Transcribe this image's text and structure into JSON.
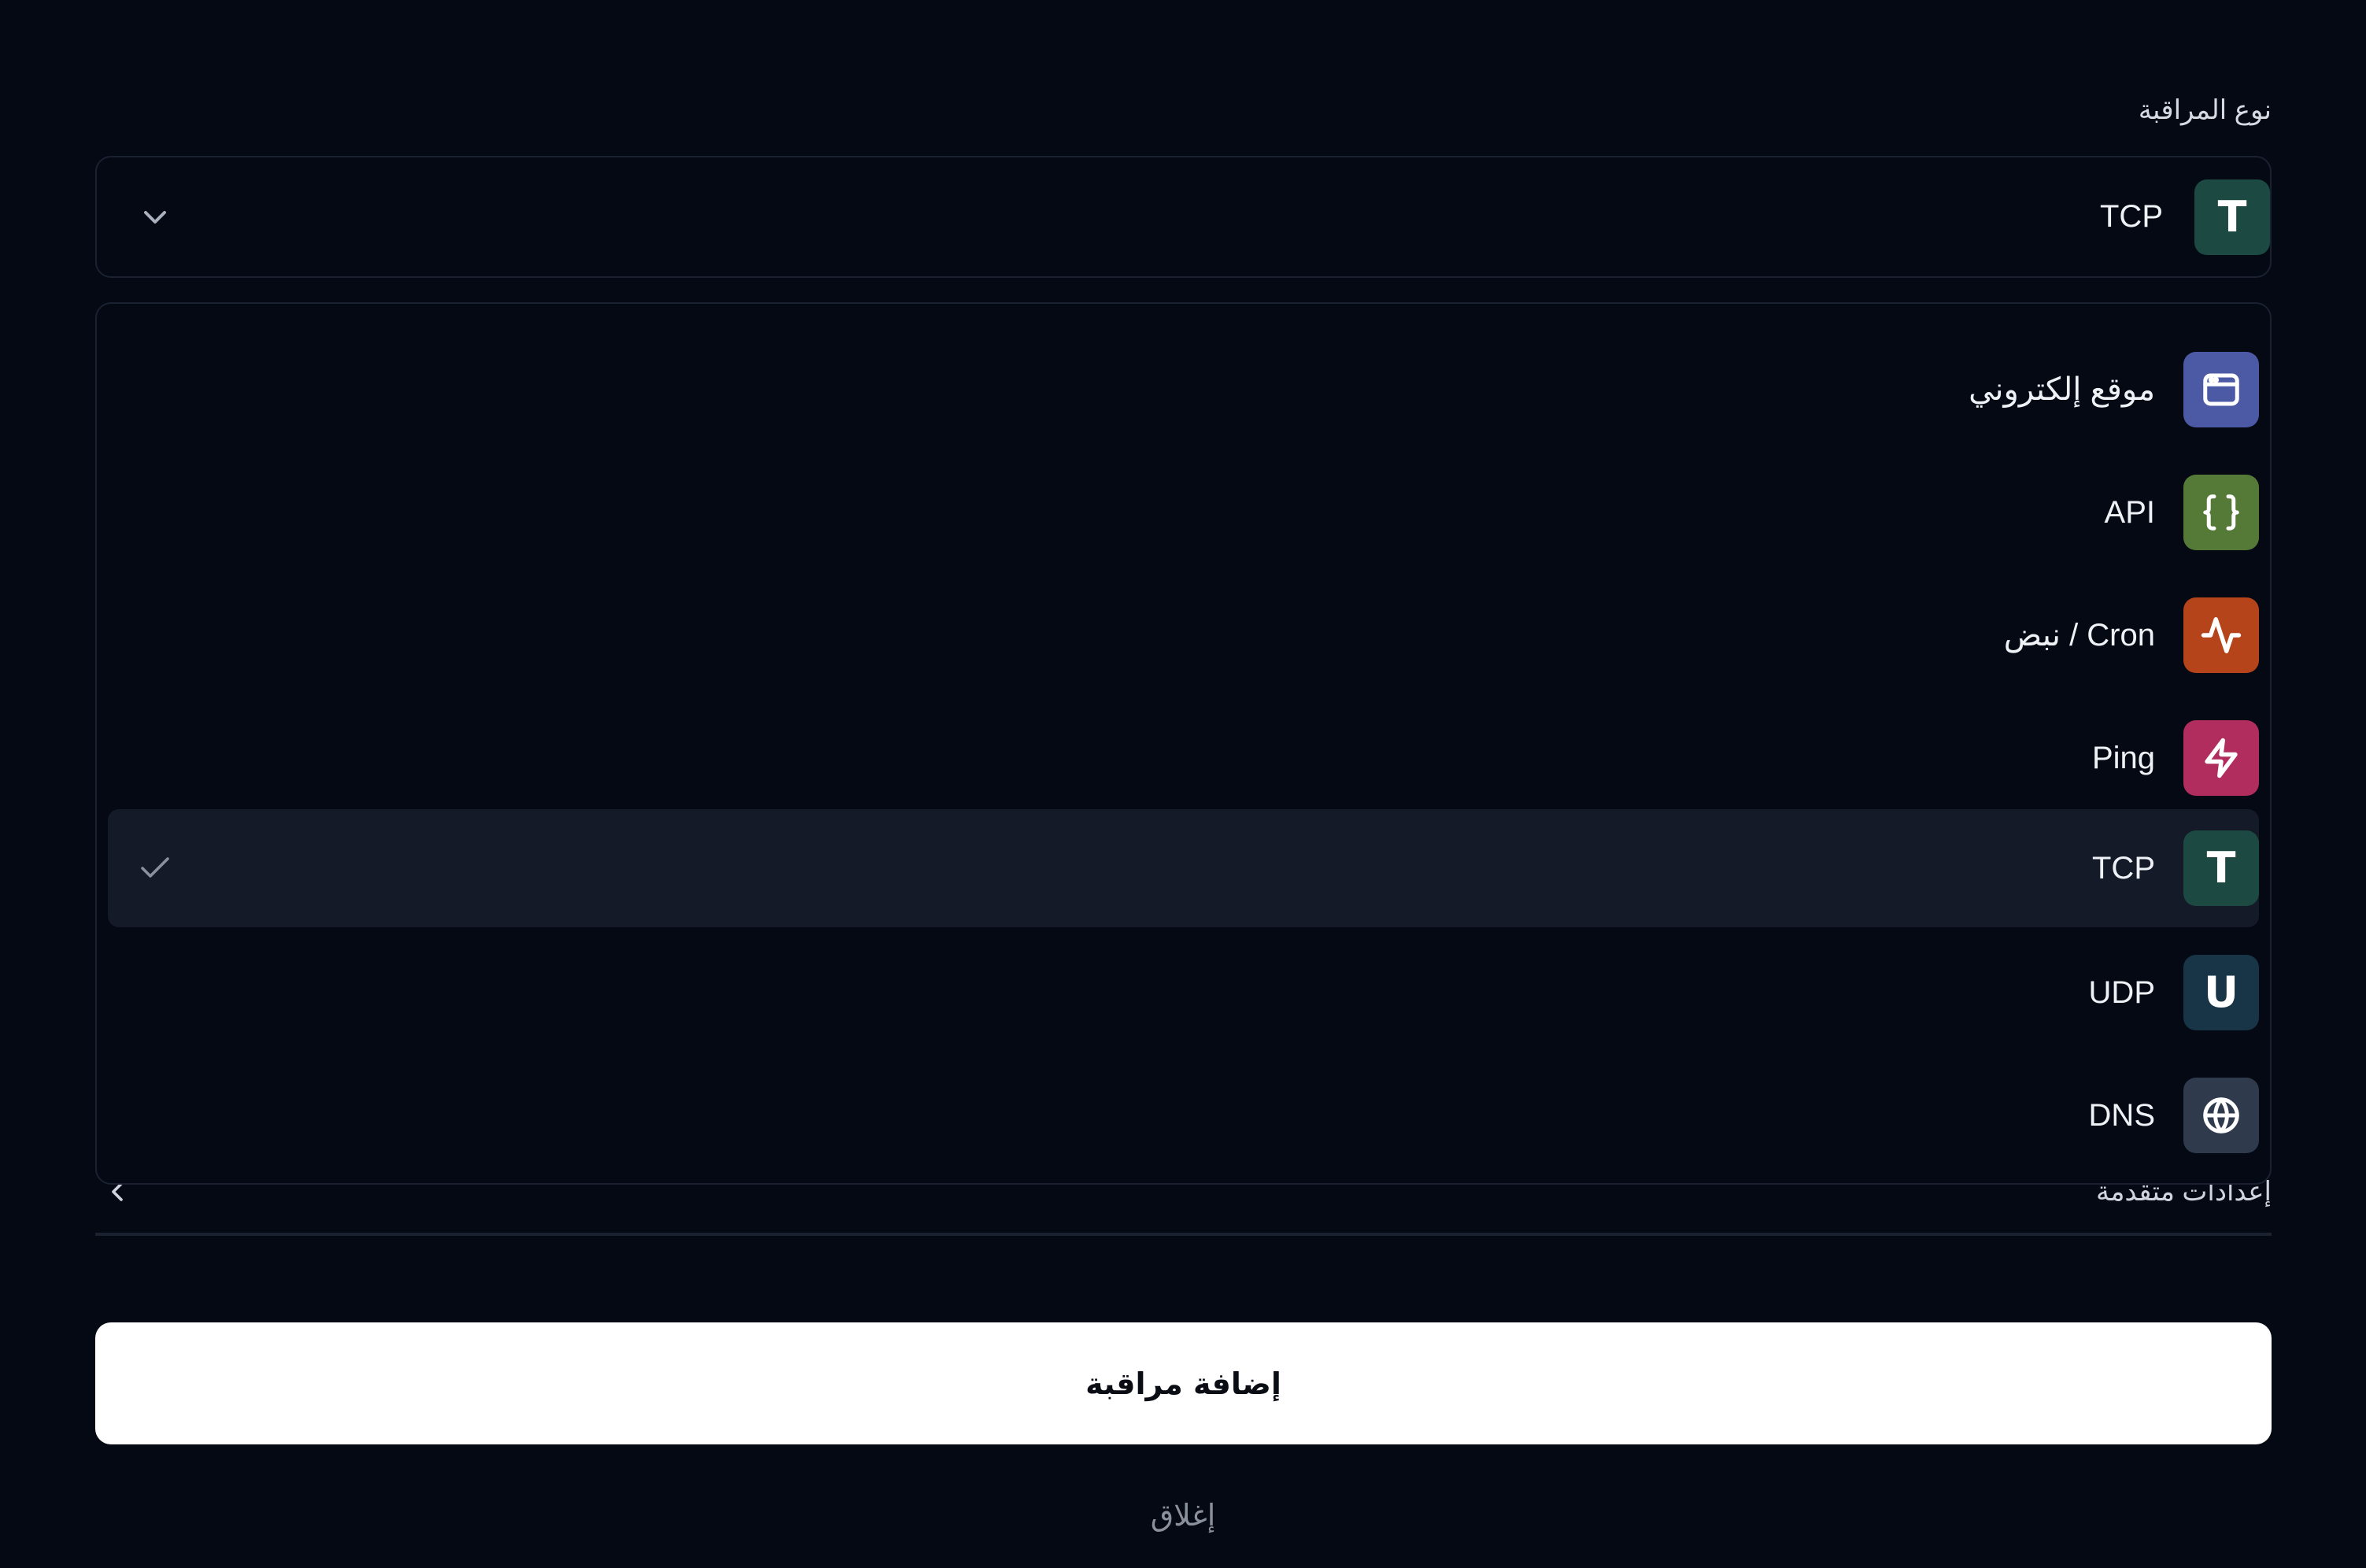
{
  "field": {
    "label": "نوع المراقبة"
  },
  "select": {
    "selected_label": "TCP",
    "selected_letter": "T",
    "selected_color": "#1c4a42"
  },
  "options": [
    {
      "label": "موقع إلكتروني",
      "icon": "browser-window-icon",
      "color": "#4c5aa6",
      "selected": false
    },
    {
      "label": "API",
      "icon": "curly-braces-icon",
      "color": "#557a38",
      "selected": false
    },
    {
      "label": "Cron / نبض",
      "icon": "activity-pulse-icon",
      "color": "#b5441a",
      "selected": false
    },
    {
      "label": "Ping",
      "icon": "lightning-bolt-icon",
      "color": "#b12d5e",
      "selected": false
    },
    {
      "label": "TCP",
      "icon": "letter-t-icon",
      "letter": "T",
      "color": "#1c4a42",
      "selected": true
    },
    {
      "label": "UDP",
      "icon": "letter-u-icon",
      "letter": "U",
      "color": "#183447",
      "selected": false
    },
    {
      "label": "DNS",
      "icon": "globe-icon",
      "color": "#2f3a4d",
      "selected": false
    }
  ],
  "advanced": {
    "label": "إعدادات متقدمة"
  },
  "actions": {
    "add_label": "إضافة مراقبة",
    "close_label": "إغلاق"
  }
}
